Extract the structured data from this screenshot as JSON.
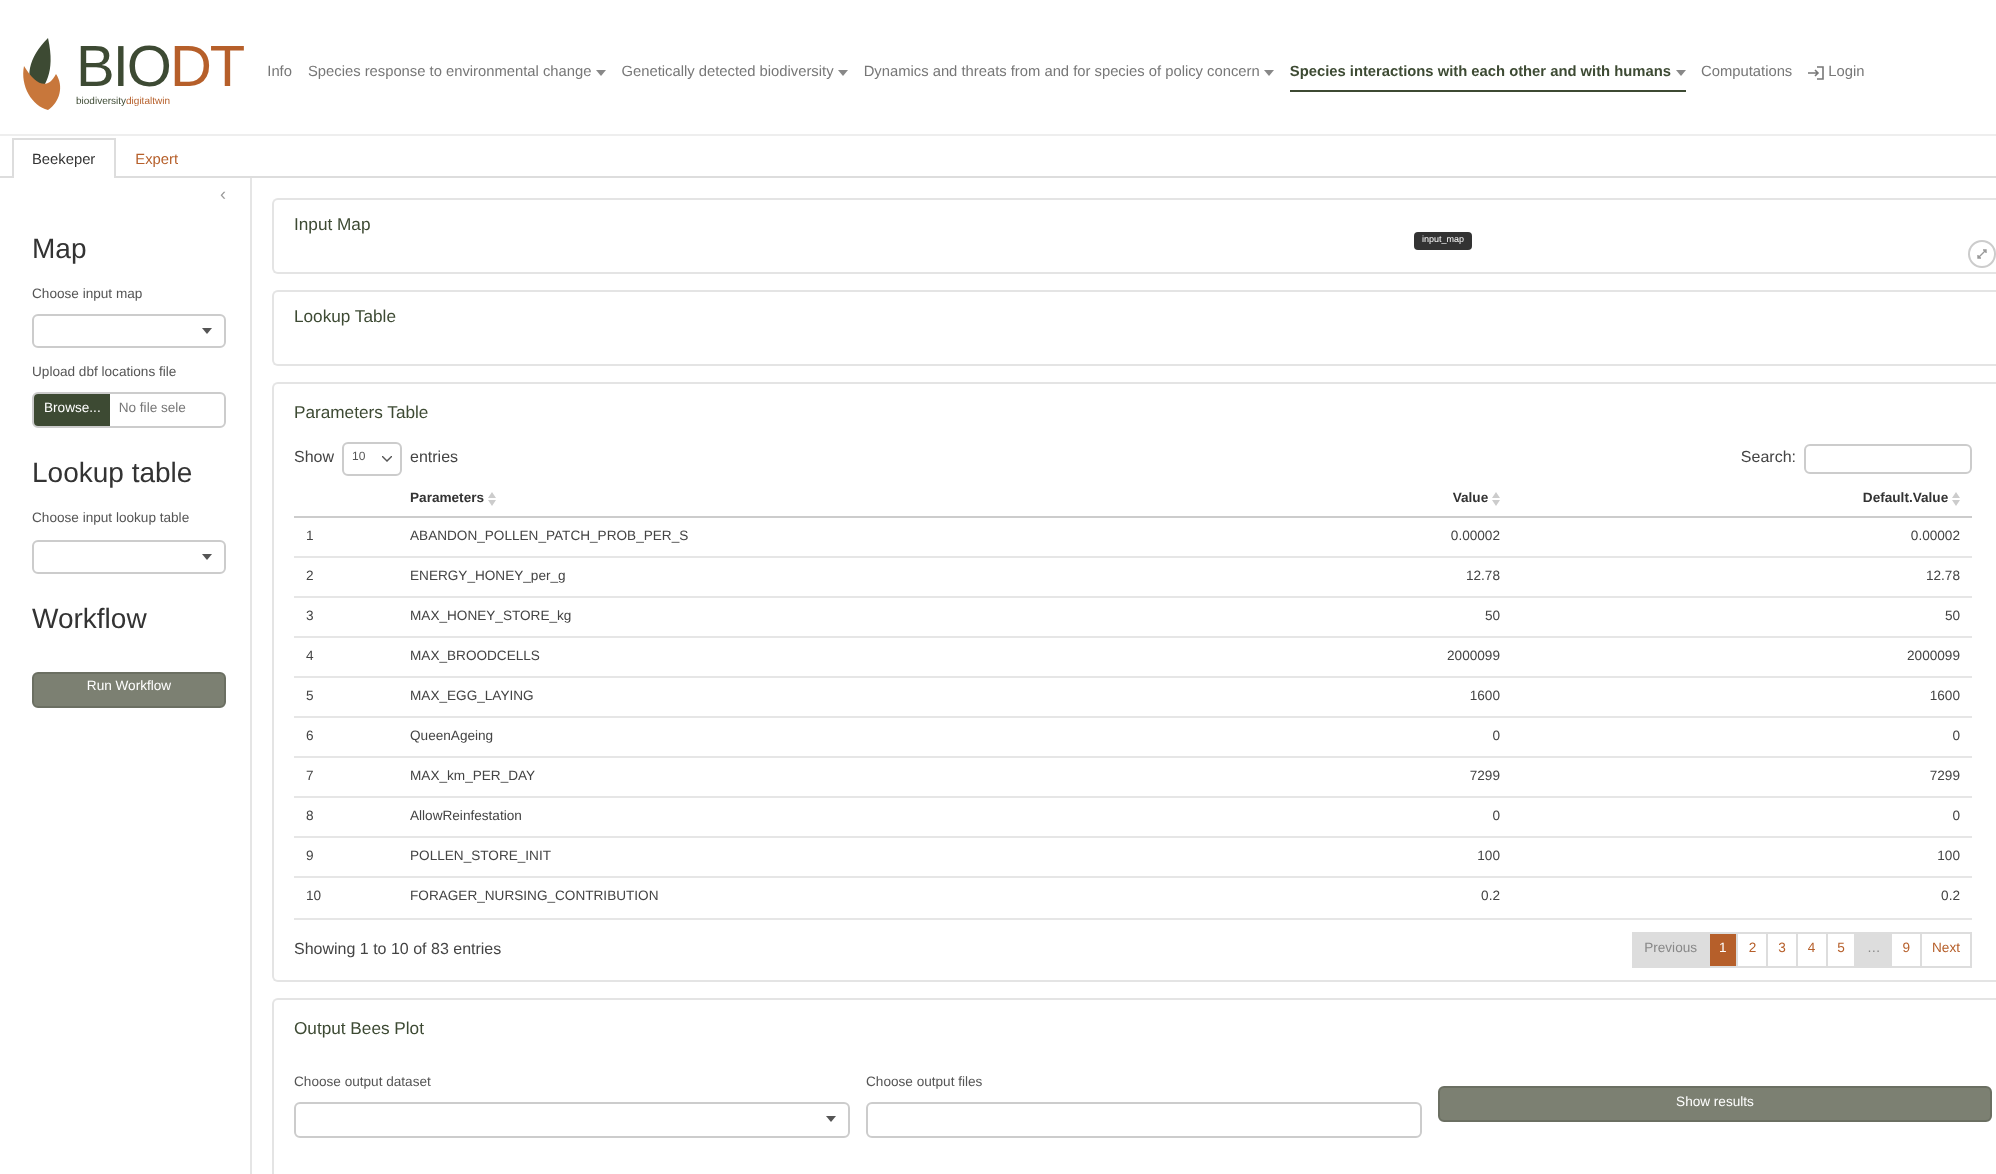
{
  "logo": {
    "main": "BIO",
    "accent": "DT",
    "sub_main": "biodiversity",
    "sub_accent": "digitaltwin"
  },
  "nav": [
    {
      "label": "Info",
      "dropdown": false,
      "selected": false,
      "kind": "link"
    },
    {
      "label": "Species response to environmental change",
      "dropdown": true,
      "selected": false,
      "kind": "link"
    },
    {
      "label": "Genetically detected biodiversity",
      "dropdown": true,
      "selected": false,
      "kind": "link"
    },
    {
      "label": "Dynamics and threats from and for species of policy concern",
      "dropdown": true,
      "selected": false,
      "kind": "link"
    },
    {
      "label": "Species interactions with each other and with humans",
      "dropdown": true,
      "selected": true,
      "kind": "link"
    },
    {
      "label": "Computations",
      "dropdown": false,
      "selected": false,
      "kind": "link"
    },
    {
      "label": "Login",
      "dropdown": false,
      "selected": false,
      "kind": "login"
    }
  ],
  "tabs": [
    {
      "label": "Beekeper",
      "selected": true
    },
    {
      "label": "Expert",
      "selected": false
    }
  ],
  "sidebar": {
    "collapse": "‹",
    "sections": [
      {
        "title": "Map",
        "fields": [
          {
            "kind": "select",
            "label": "Choose input map"
          },
          {
            "kind": "file",
            "label": "Upload dbf locations file",
            "button": "Browse...",
            "value": "No file sele"
          }
        ]
      },
      {
        "title": "Lookup table",
        "fields": [
          {
            "kind": "select",
            "label": "Choose input lookup table"
          }
        ]
      },
      {
        "title": "Workflow",
        "fields": [
          {
            "kind": "button",
            "button": "Run Workflow"
          }
        ]
      }
    ]
  },
  "input_map": {
    "title": "Input Map",
    "tooltip": "input_map"
  },
  "lookup_table": {
    "title": "Lookup Table"
  },
  "parameters_table": {
    "title": "Parameters Table",
    "show": "Show",
    "length": "10",
    "entries": "entries",
    "search_label": "Search:",
    "columns": [
      "",
      "Parameters",
      "Value",
      "Default.Value"
    ],
    "rows": [
      [
        "1",
        "ABANDON_POLLEN_PATCH_PROB_PER_S",
        "0.00002",
        "0.00002"
      ],
      [
        "2",
        "ENERGY_HONEY_per_g",
        "12.78",
        "12.78"
      ],
      [
        "3",
        "MAX_HONEY_STORE_kg",
        "50",
        "50"
      ],
      [
        "4",
        "MAX_BROODCELLS",
        "2000099",
        "2000099"
      ],
      [
        "5",
        "MAX_EGG_LAYING",
        "1600",
        "1600"
      ],
      [
        "6",
        "QueenAgeing",
        "0",
        "0"
      ],
      [
        "7",
        "MAX_km_PER_DAY",
        "7299",
        "7299"
      ],
      [
        "8",
        "AllowReinfestation",
        "0",
        "0"
      ],
      [
        "9",
        "POLLEN_STORE_INIT",
        "100",
        "100"
      ],
      [
        "10",
        "FORAGER_NURSING_CONTRIBUTION",
        "0.2",
        "0.2"
      ]
    ],
    "info": "Showing 1 to 10 of 83 entries",
    "pages": [
      {
        "label": "Previous",
        "selected": false,
        "disabled": true
      },
      {
        "label": "1",
        "selected": true,
        "disabled": false
      },
      {
        "label": "2",
        "selected": false,
        "disabled": false
      },
      {
        "label": "3",
        "selected": false,
        "disabled": false
      },
      {
        "label": "4",
        "selected": false,
        "disabled": false
      },
      {
        "label": "5",
        "selected": false,
        "disabled": false
      },
      {
        "label": "…",
        "selected": false,
        "disabled": true
      },
      {
        "label": "9",
        "selected": false,
        "disabled": false
      },
      {
        "label": "Next",
        "selected": false,
        "disabled": false
      }
    ]
  },
  "output": {
    "title": "Output Bees Plot",
    "dataset_label": "Choose output dataset",
    "files_label": "Choose output files",
    "button": "Show results"
  }
}
